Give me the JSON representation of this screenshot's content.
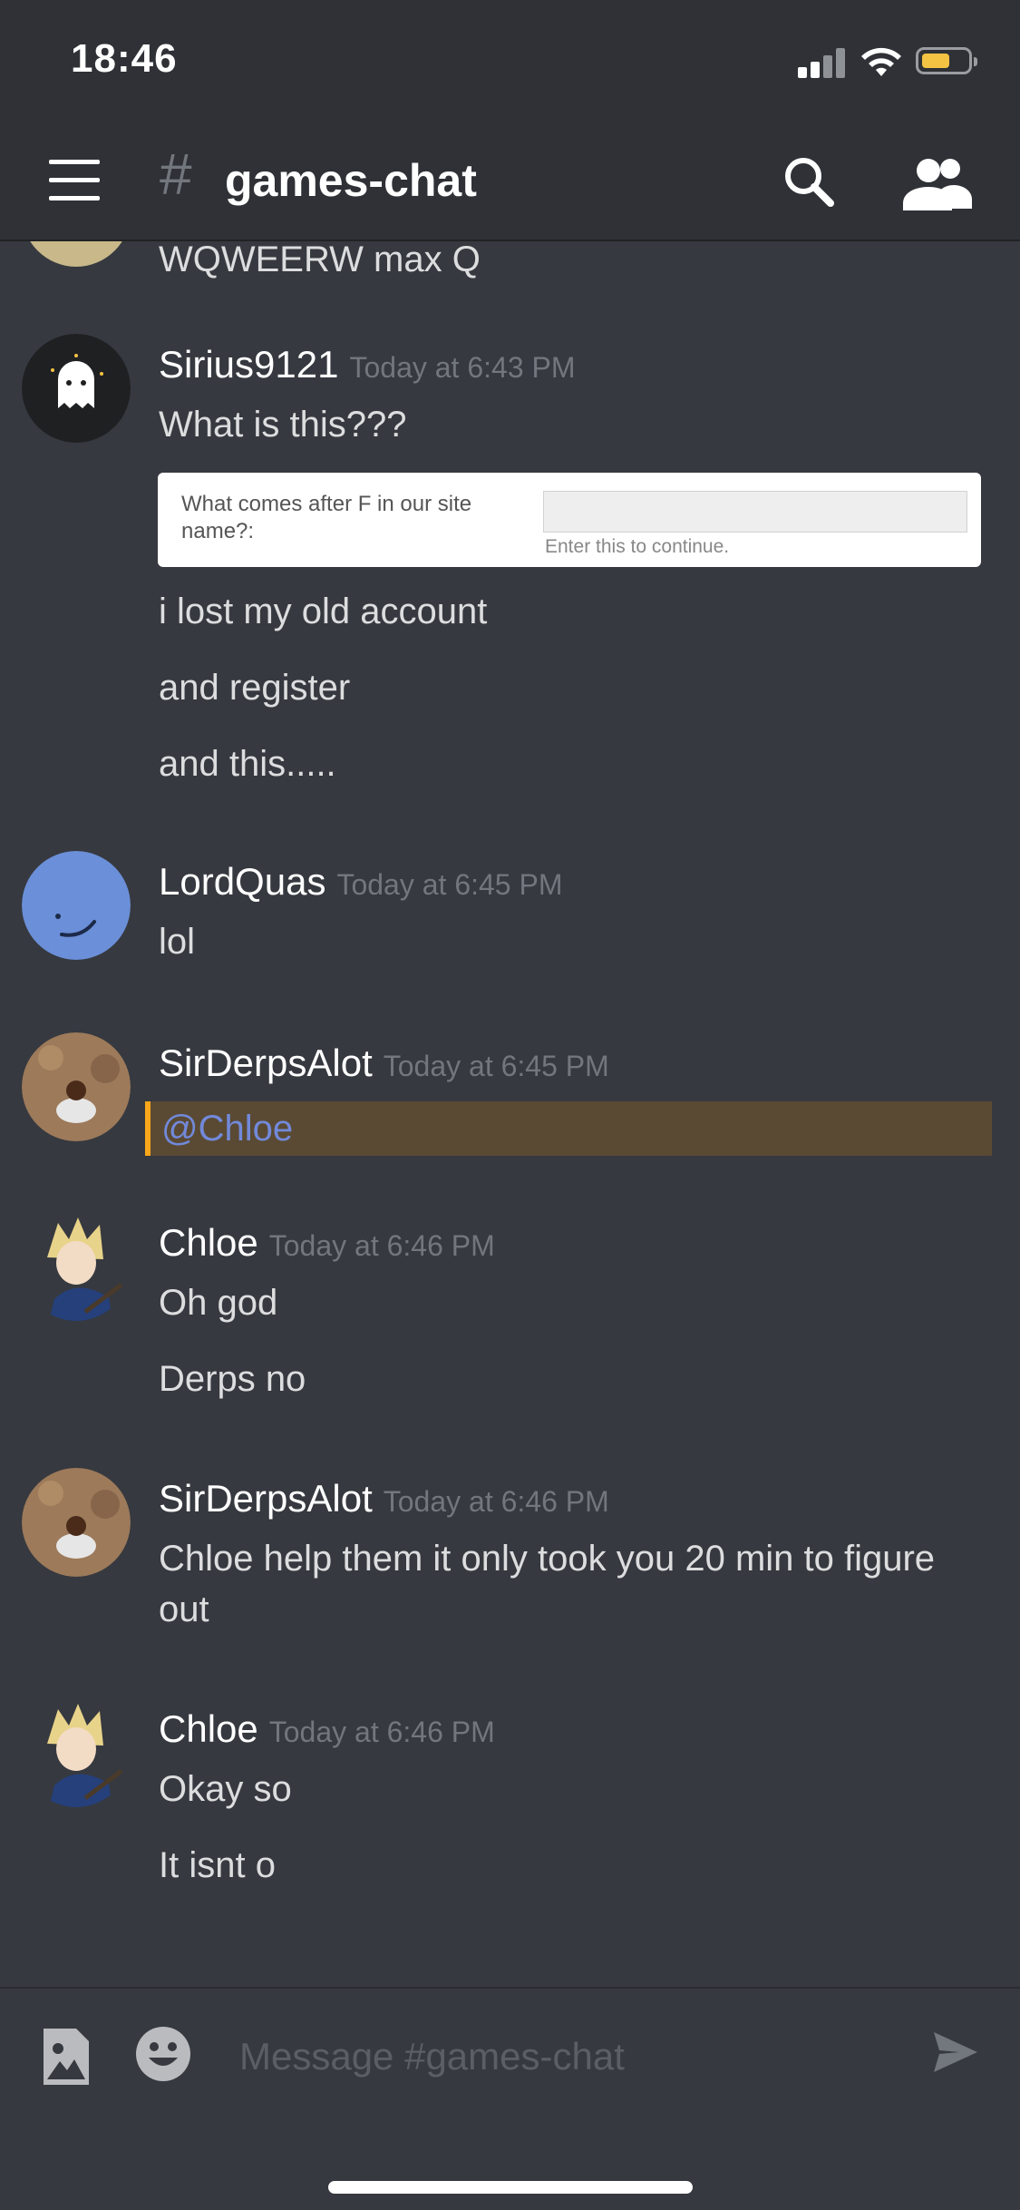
{
  "status_bar": {
    "time": "18:46"
  },
  "header": {
    "hash": "#",
    "channel": "games-chat"
  },
  "messages": {
    "partial_line": "WQWEERW max Q",
    "groups": [
      {
        "author": "Sirius9121",
        "timestamp": "Today at 6:43 PM",
        "lines": [
          "What is this???"
        ],
        "embed": {
          "question": "What comes after F in our site name?:",
          "hint": "Enter this to continue."
        },
        "lines_after": [
          "i lost my old account",
          "and register",
          "and this....."
        ]
      },
      {
        "author": "LordQuas",
        "timestamp": "Today at 6:45 PM",
        "lines": [
          "lol"
        ]
      },
      {
        "author": "SirDerpsAlot",
        "timestamp": "Today at 6:45 PM",
        "mention": "@Chloe"
      },
      {
        "author": "Chloe",
        "timestamp": "Today at 6:46 PM",
        "lines": [
          "Oh god",
          "Derps no"
        ]
      },
      {
        "author": "SirDerpsAlot",
        "timestamp": "Today at 6:46 PM",
        "lines": [
          "Chloe help them it only took you 20 min to figure out"
        ]
      },
      {
        "author": "Chloe",
        "timestamp": "Today at 6:46 PM",
        "lines": [
          "Okay so",
          "It isnt o"
        ]
      }
    ]
  },
  "composer": {
    "placeholder": "Message #games-chat"
  },
  "icons": {
    "menu": "hamburger-icon",
    "search": "search-icon",
    "members": "members-icon",
    "attach": "image-attach-icon",
    "emoji": "emoji-icon",
    "send": "send-icon"
  },
  "colors": {
    "background": "#36393f",
    "header": "#2f3136",
    "mention": "#7289da",
    "mention_highlight": "#faa61a",
    "battery": "#f5c343"
  }
}
